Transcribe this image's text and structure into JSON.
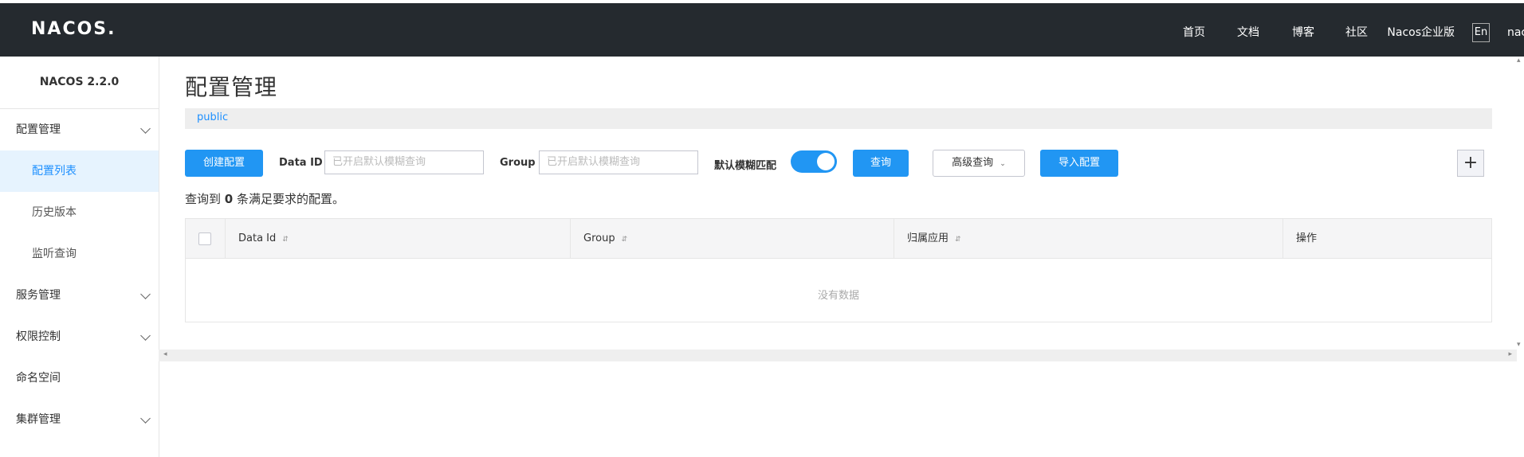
{
  "header": {
    "logo": "NACOS.",
    "nav": [
      "首页",
      "文档",
      "博客",
      "社区",
      "Nacos企业版"
    ],
    "lang": "En",
    "user": "nacos"
  },
  "sidebar": {
    "version": "NACOS 2.2.0",
    "items": [
      {
        "label": "配置管理",
        "type": "group"
      },
      {
        "label": "配置列表",
        "type": "sub",
        "active": true
      },
      {
        "label": "历史版本",
        "type": "sub"
      },
      {
        "label": "监听查询",
        "type": "sub"
      },
      {
        "label": "服务管理",
        "type": "group"
      },
      {
        "label": "权限控制",
        "type": "group"
      },
      {
        "label": "命名空间",
        "type": "item"
      },
      {
        "label": "集群管理",
        "type": "group"
      }
    ]
  },
  "main": {
    "title": "配置管理",
    "namespace": "public",
    "create_button": "创建配置",
    "dataid_label": "Data ID",
    "dataid_placeholder": "已开启默认模糊查询",
    "group_label": "Group",
    "group_placeholder": "已开启默认模糊查询",
    "fuzzy_label": "默认模糊匹配",
    "fuzzy_enabled": true,
    "query_button": "查询",
    "advanced_button": "高级查询",
    "import_button": "导入配置",
    "plus_icon": "+",
    "result_prefix": "查询到",
    "result_count": "0",
    "result_suffix": "条满足要求的配置。",
    "columns": [
      "Data Id",
      "Group",
      "归属应用",
      "操作"
    ],
    "empty_text": "没有数据"
  },
  "colors": {
    "primary": "#2196f3",
    "header_bg": "#252a2f",
    "active_bg": "#e6f3fe"
  }
}
